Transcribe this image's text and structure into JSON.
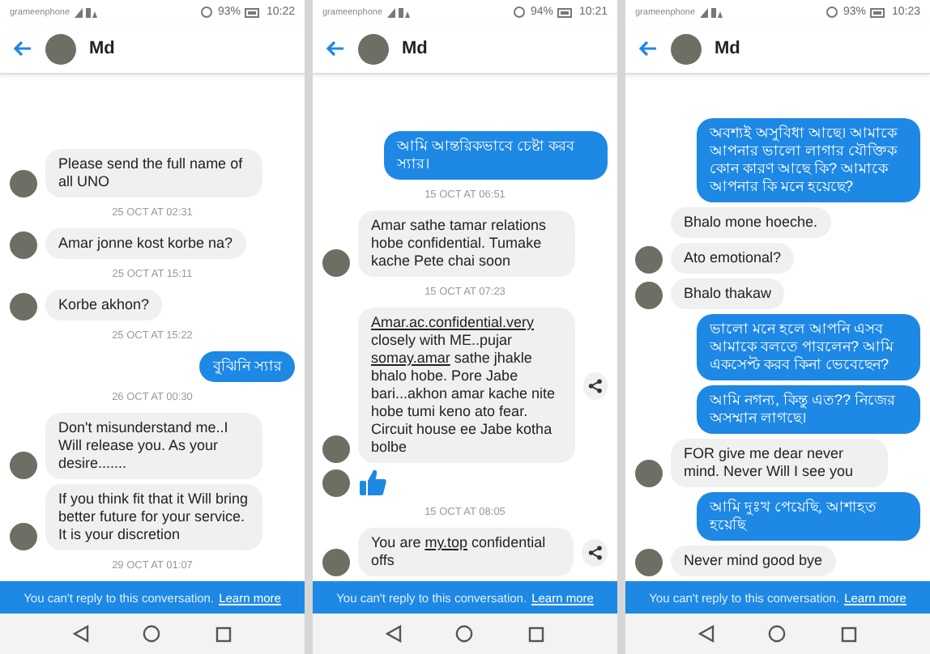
{
  "panels": [
    {
      "status_bar": {
        "carrier": "grameenphone",
        "battery": "93%",
        "time": "10:22"
      },
      "header": {
        "name": "Md"
      },
      "messages": [
        {
          "kind": "incoming",
          "avatar": true,
          "share": false,
          "parts": [
            {
              "text": "Please send the full name of all UNO",
              "link": false
            }
          ]
        },
        {
          "kind": "timestamp",
          "text": "25 OCT AT 02:31"
        },
        {
          "kind": "incoming",
          "avatar": true,
          "share": false,
          "parts": [
            {
              "text": "Amar jonne kost korbe na?",
              "link": false
            }
          ]
        },
        {
          "kind": "timestamp",
          "text": "25 OCT AT 15:11"
        },
        {
          "kind": "incoming",
          "avatar": true,
          "share": false,
          "parts": [
            {
              "text": "Korbe akhon?",
              "link": false
            }
          ]
        },
        {
          "kind": "timestamp",
          "text": "25 OCT AT 15:22"
        },
        {
          "kind": "outgoing",
          "text": "বুঝিনি স্যার"
        },
        {
          "kind": "timestamp",
          "text": "26 OCT AT 00:30"
        },
        {
          "kind": "incoming",
          "avatar": true,
          "share": false,
          "parts": [
            {
              "text": "Don't misunderstand me..I Will release you. As your desire.......",
              "link": false
            }
          ]
        },
        {
          "kind": "incoming",
          "avatar": true,
          "share": false,
          "parts": [
            {
              "text": "If you think  fit that it Will bring better  future for your service. It is your discretion",
              "link": false
            }
          ]
        },
        {
          "kind": "timestamp",
          "text": "29 OCT AT 01:07"
        }
      ],
      "banner": {
        "text": "You can't reply to this conversation.",
        "link": "Learn more"
      }
    },
    {
      "status_bar": {
        "carrier": "grameenphone",
        "battery": "94%",
        "time": "10:21"
      },
      "header": {
        "name": "Md"
      },
      "messages": [
        {
          "kind": "outgoing",
          "text": "আমি আন্তরিকভাবে চেষ্টা করব স্যার।"
        },
        {
          "kind": "timestamp",
          "text": "15 OCT AT 06:51"
        },
        {
          "kind": "incoming",
          "avatar": true,
          "share": false,
          "parts": [
            {
              "text": "Amar sathe tamar relations hobe confidential. Tumake kache Pete chai soon",
              "link": false
            }
          ]
        },
        {
          "kind": "timestamp",
          "text": "15 OCT AT 07:23"
        },
        {
          "kind": "incoming",
          "avatar": true,
          "share": true,
          "parts": [
            {
              "text": "Amar.ac.confidential.very",
              "link": true
            },
            {
              "text": " closely with ME..pujar ",
              "link": false
            },
            {
              "text": "somay.amar",
              "link": true
            },
            {
              "text": " sathe  jhakle bhalo hobe. Pore Jabe bari...akhon amar kache nite hobe tumi keno ato fear. Circuit house ee Jabe kotha bolbe",
              "link": false
            }
          ]
        },
        {
          "kind": "like",
          "avatar": true
        },
        {
          "kind": "timestamp",
          "text": "15 OCT AT 08:05"
        },
        {
          "kind": "incoming",
          "avatar": true,
          "share": true,
          "parts": [
            {
              "text": "You are ",
              "link": false
            },
            {
              "text": "my.top",
              "link": true
            },
            {
              "text": " confidential offs",
              "link": false
            }
          ]
        }
      ],
      "banner": {
        "text": "You can't reply to this conversation.",
        "link": "Learn more"
      }
    },
    {
      "status_bar": {
        "carrier": "grameenphone",
        "battery": "93%",
        "time": "10:23"
      },
      "header": {
        "name": "Md"
      },
      "messages": [
        {
          "kind": "outgoing",
          "text": "অবশ্যই অসুবিধা আছে। আমাকে আপনার ভালো লাগার যৌক্তিক কোন কারণ আছে কি? আমাকে আপনার কি মনে হয়েছে?"
        },
        {
          "kind": "incoming",
          "avatar": false,
          "share": false,
          "parts": [
            {
              "text": "Bhalo mone hoeche.",
              "link": false
            }
          ]
        },
        {
          "kind": "incoming",
          "avatar": true,
          "share": false,
          "parts": [
            {
              "text": "Ato emotional?",
              "link": false
            }
          ]
        },
        {
          "kind": "incoming",
          "avatar": true,
          "share": false,
          "parts": [
            {
              "text": "Bhalo thakaw",
              "link": false
            }
          ]
        },
        {
          "kind": "outgoing",
          "text": "ভালো মনে হলে আপনি এসব আমাকে বলতে পারলেন? আমি একসেপ্ট করব কিনা ভেবেছেন?"
        },
        {
          "kind": "outgoing",
          "text": "আমি নগন্য, কিন্তু এত?? নিজের অসম্মান লাগছে।"
        },
        {
          "kind": "incoming",
          "avatar": true,
          "share": false,
          "parts": [
            {
              "text": "FOR give me dear never mind. Never Will I see you",
              "link": false
            }
          ]
        },
        {
          "kind": "outgoing",
          "text": "আমি দুঃখ পেয়েছি, আশাহত হয়েছি"
        },
        {
          "kind": "incoming",
          "avatar": true,
          "share": false,
          "parts": [
            {
              "text": "Never mind good bye",
              "link": false
            }
          ]
        }
      ],
      "banner": {
        "text": "You can't reply to this conversation.",
        "link": "Learn more"
      }
    }
  ]
}
